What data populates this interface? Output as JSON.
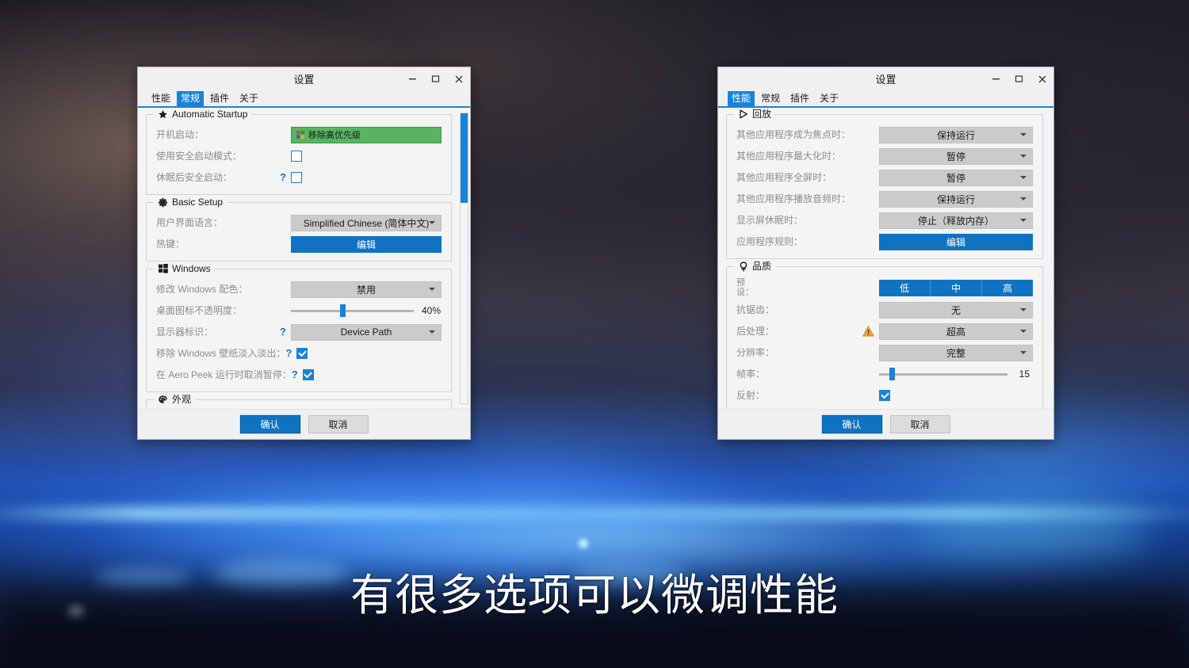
{
  "subtitle": "有很多选项可以微调性能",
  "window_left": {
    "title": "设置",
    "controls": {
      "minimize": "–",
      "maximize": "▫",
      "close": "✕"
    },
    "tabs": [
      {
        "label": "性能",
        "active": false
      },
      {
        "label": "常规",
        "active": true
      },
      {
        "label": "插件",
        "active": false
      },
      {
        "label": "关于",
        "active": false
      }
    ],
    "groups": [
      {
        "title": "Automatic Startup",
        "icon": "star-icon",
        "rows": [
          {
            "label": "开机启动：",
            "help": false,
            "control": "green-button",
            "value": "移除高优先级"
          },
          {
            "label": "使用安全启动模式：",
            "help": false,
            "control": "checkbox",
            "checked": false
          },
          {
            "label": "休眠后安全启动：",
            "help": true,
            "control": "checkbox",
            "checked": false
          }
        ]
      },
      {
        "title": "Basic Setup",
        "icon": "gear-icon",
        "rows": [
          {
            "label": "用户界面语言：",
            "help": false,
            "control": "combobox",
            "value": "Simplified Chinese (简体中文)"
          },
          {
            "label": "热键：",
            "help": false,
            "control": "blue-button",
            "value": "编辑"
          }
        ]
      },
      {
        "title": "Windows",
        "icon": "windows-icon",
        "rows": [
          {
            "label": "修改 Windows 配色：",
            "help": false,
            "control": "combobox",
            "value": "禁用"
          },
          {
            "label": "桌面图标不透明度：",
            "help": false,
            "control": "slider",
            "value": "40%",
            "percent": 40
          },
          {
            "label": "显示器标识：",
            "help": true,
            "control": "combobox",
            "value": "Device Path"
          },
          {
            "label": "移除 Windows 壁纸淡入淡出：",
            "help": true,
            "control": "checkbox",
            "checked": true
          },
          {
            "label": "在 Aero Peek 运行时取消暂停：",
            "help": true,
            "control": "checkbox",
            "checked": true
          }
        ]
      },
      {
        "title": "外观",
        "icon": "palette-icon",
        "rows": []
      }
    ],
    "scrollbar": {
      "thumb_top_percent": 0,
      "thumb_height_percent": 31
    },
    "footer": {
      "ok": "确认",
      "cancel": "取消"
    }
  },
  "window_right": {
    "title": "设置",
    "controls": {
      "minimize": "–",
      "maximize": "▫",
      "close": "✕"
    },
    "tabs": [
      {
        "label": "性能",
        "active": true
      },
      {
        "label": "常规",
        "active": false
      },
      {
        "label": "插件",
        "active": false
      },
      {
        "label": "关于",
        "active": false
      }
    ],
    "groups": [
      {
        "title": "回放",
        "icon": "play-icon",
        "rows": [
          {
            "label": "其他应用程序成为焦点时：",
            "control": "combobox",
            "value": "保持运行"
          },
          {
            "label": "其他应用程序最大化时：",
            "control": "combobox",
            "value": "暂停"
          },
          {
            "label": "其他应用程序全屏时：",
            "control": "combobox",
            "value": "暂停"
          },
          {
            "label": "其他应用程序播放音频时：",
            "control": "combobox",
            "value": "保持运行"
          },
          {
            "label": "显示屏休眠时：",
            "control": "combobox",
            "value": "停止（释放内存）"
          },
          {
            "label": "应用程序规则：",
            "control": "blue-button",
            "value": "编辑"
          }
        ]
      },
      {
        "title": "品质",
        "icon": "quality-icon",
        "rows": [
          {
            "label": "预\n设：",
            "control": "segmented",
            "options": [
              "低",
              "中",
              "高"
            ]
          },
          {
            "label": "抗锯齿：",
            "control": "combobox",
            "value": "无"
          },
          {
            "label": "后处理：",
            "control": "combobox",
            "value": "超高",
            "warning": true
          },
          {
            "label": "分辨率：",
            "control": "combobox",
            "value": "完整"
          },
          {
            "label": "帧率：",
            "control": "slider",
            "value": "15",
            "percent": 8
          },
          {
            "label": "反射：",
            "control": "checkbox",
            "checked": true
          }
        ]
      }
    ],
    "footer": {
      "ok": "确认",
      "cancel": "取消"
    }
  },
  "colors": {
    "accent_blue": "#1a82d8",
    "button_blue": "#1073c2",
    "green_button": "#58b461",
    "warning_orange": "#e8a33d",
    "combo_gray": "#cbcbcb",
    "window_bg": "#f4f4f4"
  }
}
